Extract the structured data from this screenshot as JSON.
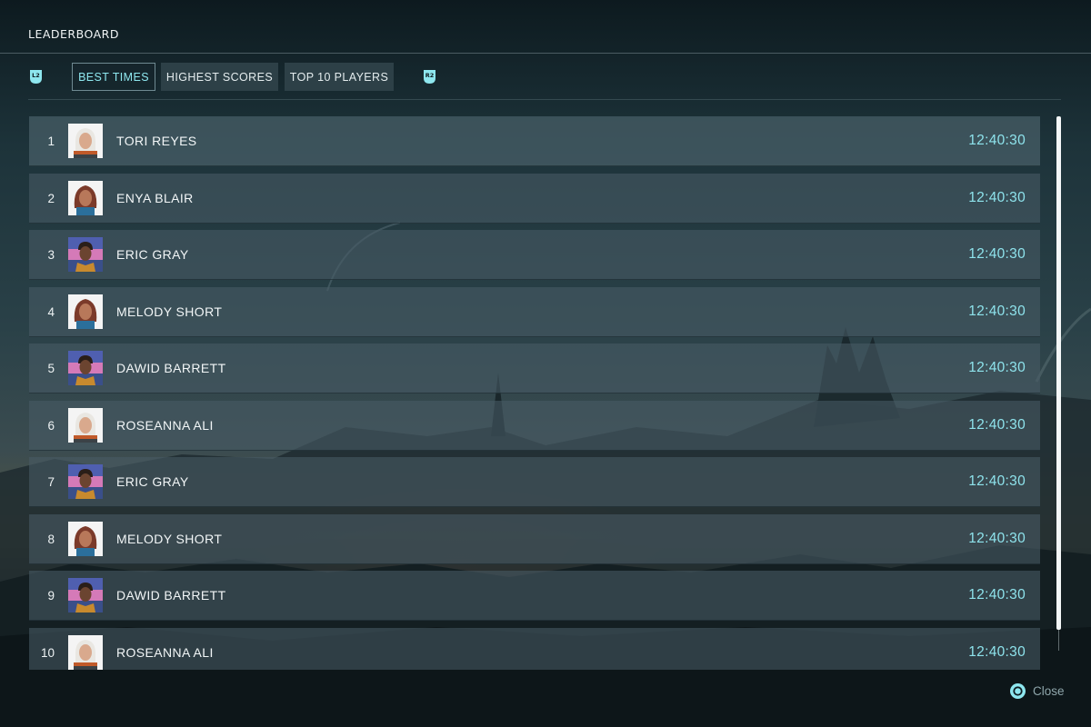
{
  "header": {
    "title": "LEADERBOARD"
  },
  "tabs": {
    "left_shoulder": "L2",
    "right_shoulder": "R2",
    "items": [
      {
        "label": "BEST TIMES",
        "active": true
      },
      {
        "label": "HIGHEST SCORES",
        "active": false
      },
      {
        "label": "TOP 10 PLAYERS",
        "active": false
      }
    ]
  },
  "leaderboard": {
    "rows": [
      {
        "rank": "1",
        "name": "TORI REYES",
        "time": "12:40:30",
        "avatar": "white-hair-avatar"
      },
      {
        "rank": "2",
        "name": "ENYA BLAIR",
        "time": "12:40:30",
        "avatar": "red-hair-avatar"
      },
      {
        "rank": "3",
        "name": "ERIC GRAY",
        "time": "12:40:30",
        "avatar": "dark-hair-avatar"
      },
      {
        "rank": "4",
        "name": "MELODY SHORT",
        "time": "12:40:30",
        "avatar": "red-hair-avatar"
      },
      {
        "rank": "5",
        "name": "DAWID BARRETT",
        "time": "12:40:30",
        "avatar": "dark-hair-avatar"
      },
      {
        "rank": "6",
        "name": "ROSEANNA ALI",
        "time": "12:40:30",
        "avatar": "white-hair-avatar"
      },
      {
        "rank": "7",
        "name": "ERIC GRAY",
        "time": "12:40:30",
        "avatar": "dark-hair-avatar"
      },
      {
        "rank": "8",
        "name": "MELODY SHORT",
        "time": "12:40:30",
        "avatar": "red-hair-avatar"
      },
      {
        "rank": "9",
        "name": "DAWID BARRETT",
        "time": "12:40:30",
        "avatar": "dark-hair-avatar"
      },
      {
        "rank": "10",
        "name": "ROSEANNA ALI",
        "time": "12:40:30",
        "avatar": "white-hair-avatar"
      }
    ]
  },
  "footer": {
    "close_label": "Close",
    "close_icon": "circle-button-icon"
  },
  "colors": {
    "accent": "#8ee3ec",
    "row_bg": "#485c66",
    "text": "#f2f6f7",
    "muted": "#8fa6ab"
  }
}
